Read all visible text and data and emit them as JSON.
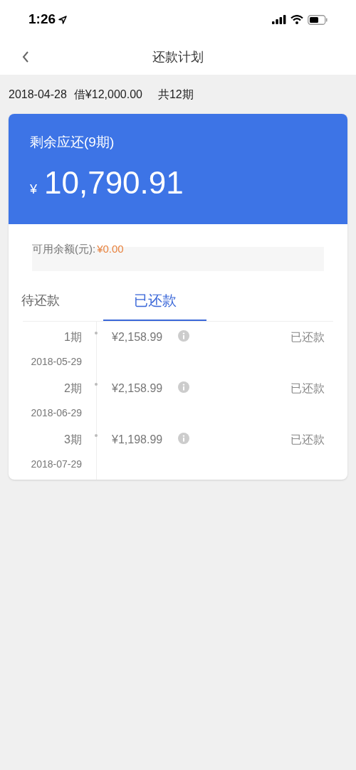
{
  "status_bar": {
    "time": "1:26"
  },
  "nav": {
    "title": "还款计划"
  },
  "loan": {
    "date": "2018-04-28",
    "amount": "借¥12,000.00",
    "terms": "共12期"
  },
  "summary": {
    "label": "剩余应还(9期)",
    "currency": "¥",
    "amount": "10,790.91"
  },
  "balance": {
    "label": "可用余额(元):",
    "value": "¥0.00"
  },
  "tabs": [
    {
      "label": "待还款",
      "selected": false
    },
    {
      "label": "已还款",
      "selected": true
    }
  ],
  "rows": [
    {
      "term": "1期",
      "date": "2018-05-29",
      "amount": "¥2,158.99",
      "status": "已还款"
    },
    {
      "term": "2期",
      "date": "2018-06-29",
      "amount": "¥2,158.99",
      "status": "已还款"
    },
    {
      "term": "3期",
      "date": "2018-07-29",
      "amount": "¥1,198.99",
      "status": "已还款"
    }
  ]
}
